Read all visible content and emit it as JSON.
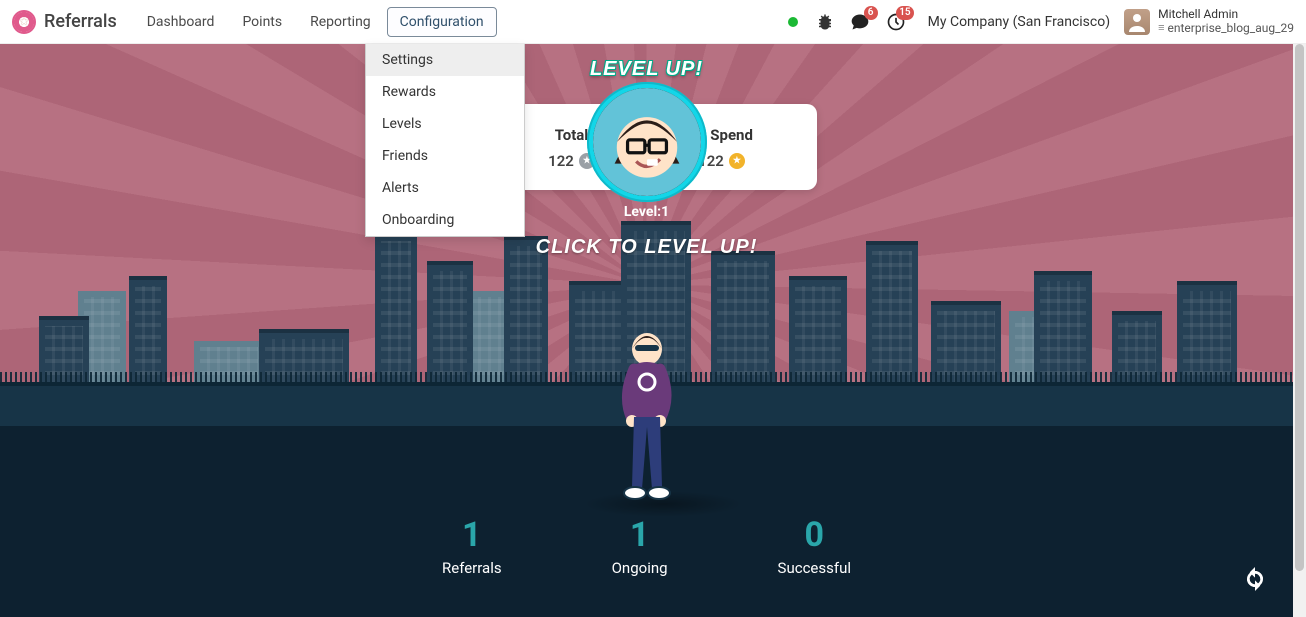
{
  "brand": {
    "title": "Referrals"
  },
  "nav": {
    "items": [
      {
        "label": "Dashboard"
      },
      {
        "label": "Points"
      },
      {
        "label": "Reporting"
      },
      {
        "label": "Configuration"
      }
    ]
  },
  "dropdown": {
    "items": [
      {
        "label": "Settings"
      },
      {
        "label": "Rewards"
      },
      {
        "label": "Levels"
      },
      {
        "label": "Friends"
      },
      {
        "label": "Alerts"
      },
      {
        "label": "Onboarding"
      }
    ]
  },
  "systray": {
    "messages_badge": "6",
    "activities_badge": "15",
    "company": "My Company (San Francisco)",
    "user_name": "Mitchell Admin",
    "db_name": "enterprise_blog_aug_29"
  },
  "stats": {
    "total_label": "Total",
    "total_value": "122",
    "spend_label": "To Spend",
    "spend_value": "122"
  },
  "hero": {
    "levelup": "Level up!",
    "level_text": "Level:1",
    "click_hint": "Click to level up!"
  },
  "counters": [
    {
      "value": "1",
      "label": "Referrals"
    },
    {
      "value": "1",
      "label": "Ongoing"
    },
    {
      "value": "0",
      "label": "Successful"
    }
  ]
}
